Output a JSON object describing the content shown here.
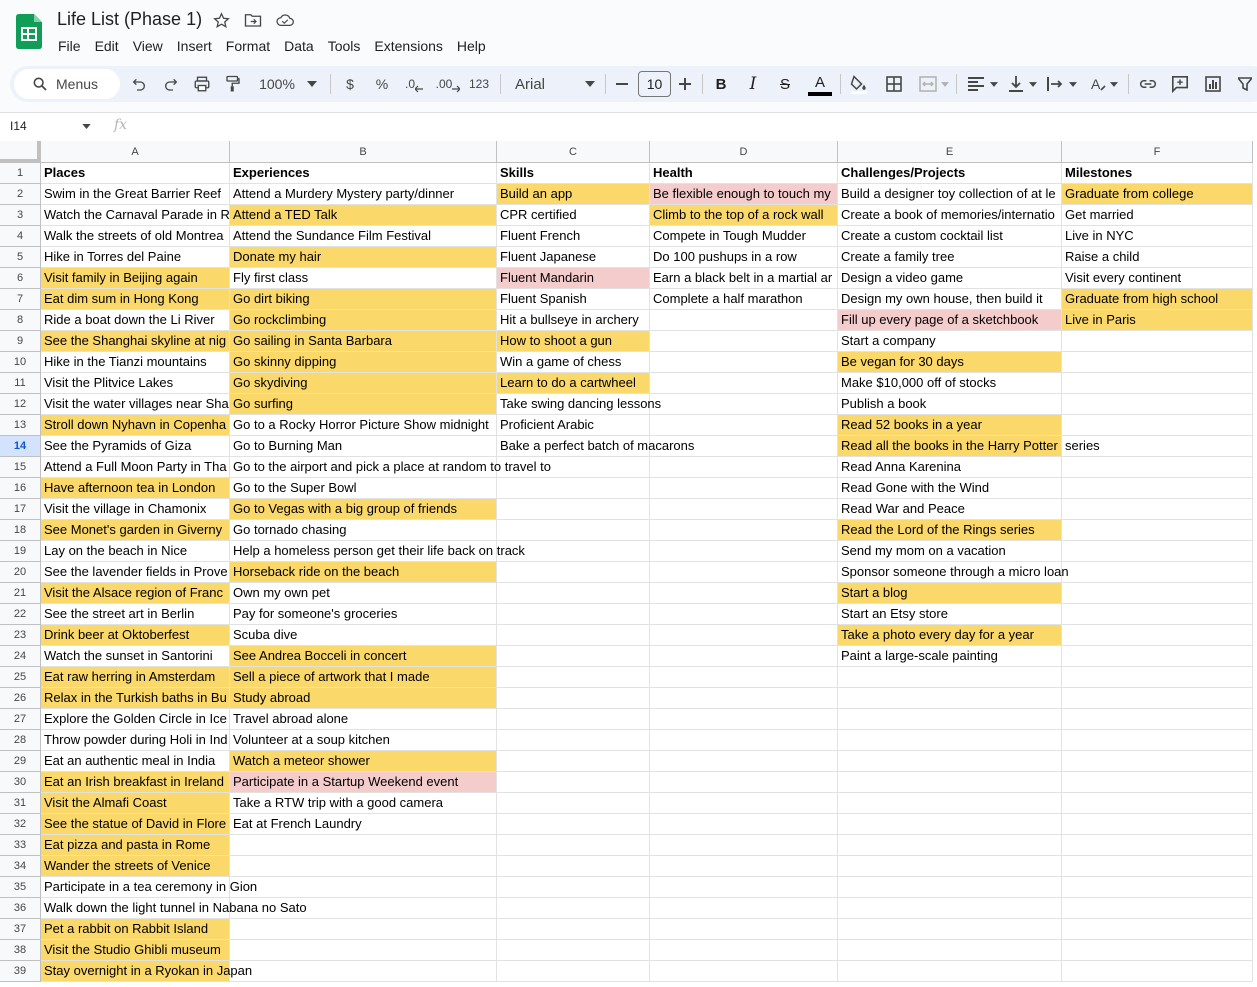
{
  "title": "Life List (Phase 1)",
  "menu": [
    "File",
    "Edit",
    "View",
    "Insert",
    "Format",
    "Data",
    "Tools",
    "Extensions",
    "Help"
  ],
  "toolbar": {
    "search_label": "Menus",
    "zoom": "100%",
    "currency": "$",
    "percent": "%",
    "decrease_decimal": ".0",
    "increase_decimal": ".00",
    "number_format": "123",
    "font": "Arial",
    "font_size": "10"
  },
  "formula": {
    "name_box": "I14",
    "fx": "fx",
    "value": ""
  },
  "columns": [
    "A",
    "B",
    "C",
    "D",
    "E",
    "F"
  ],
  "selected_row": 14,
  "rows": [
    [
      {
        "t": "Places",
        "h": 1
      },
      {
        "t": "Experiences",
        "h": 1
      },
      {
        "t": "Skills",
        "h": 1
      },
      {
        "t": "Health",
        "h": 1
      },
      {
        "t": "Challenges/Projects",
        "h": 1
      },
      {
        "t": "Milestones",
        "h": 1
      }
    ],
    [
      {
        "t": "Swim in the Great Barrier Reef"
      },
      {
        "t": "Attend a Murdery Mystery party/dinner"
      },
      {
        "t": "Build an app",
        "c": "y"
      },
      {
        "t": "Be flexible enough to touch my",
        "c": "p"
      },
      {
        "t": "Build a designer toy collection of at le"
      },
      {
        "t": "Graduate from college",
        "c": "y"
      }
    ],
    [
      {
        "t": "Watch the Carnaval Parade in R"
      },
      {
        "t": "Attend a TED Talk",
        "c": "y"
      },
      {
        "t": "CPR certified"
      },
      {
        "t": "Climb to the top of a rock wall",
        "c": "y"
      },
      {
        "t": "Create a book of memories/internatio"
      },
      {
        "t": "Get married"
      }
    ],
    [
      {
        "t": "Walk the streets of old Montrea"
      },
      {
        "t": "Attend the Sundance Film Festival"
      },
      {
        "t": "Fluent French"
      },
      {
        "t": "Compete in Tough Mudder"
      },
      {
        "t": "Create a custom cocktail list"
      },
      {
        "t": "Live in NYC"
      }
    ],
    [
      {
        "t": "Hike in Torres del Paine"
      },
      {
        "t": "Donate my hair",
        "c": "y"
      },
      {
        "t": "Fluent Japanese"
      },
      {
        "t": "Do 100 pushups in a row"
      },
      {
        "t": "Create a family tree"
      },
      {
        "t": "Raise a child"
      }
    ],
    [
      {
        "t": "Visit family in Beijing again",
        "c": "y"
      },
      {
        "t": "Fly first class"
      },
      {
        "t": "Fluent Mandarin",
        "c": "p"
      },
      {
        "t": "Earn a black belt in a martial ar"
      },
      {
        "t": "Design a video game"
      },
      {
        "t": "Visit every continent"
      }
    ],
    [
      {
        "t": "Eat dim sum in Hong Kong",
        "c": "y"
      },
      {
        "t": "Go dirt biking",
        "c": "y"
      },
      {
        "t": "Fluent Spanish"
      },
      {
        "t": "Complete a half marathon"
      },
      {
        "t": "Design my own house, then build it"
      },
      {
        "t": "Graduate from high school",
        "c": "y"
      }
    ],
    [
      {
        "t": "Ride a boat down the Li River"
      },
      {
        "t": "Go rockclimbing",
        "c": "y"
      },
      {
        "t": "Hit a bullseye in archery"
      },
      {
        "t": ""
      },
      {
        "t": "Fill up every page of a sketchbook",
        "c": "p"
      },
      {
        "t": "Live in Paris",
        "c": "y"
      }
    ],
    [
      {
        "t": "See the Shanghai skyline at nig",
        "c": "y"
      },
      {
        "t": "Go sailing in Santa Barbara",
        "c": "y"
      },
      {
        "t": "How to shoot a gun",
        "c": "y"
      },
      {
        "t": ""
      },
      {
        "t": "Start a company"
      },
      {
        "t": ""
      }
    ],
    [
      {
        "t": "Hike in the Tianzi mountains"
      },
      {
        "t": "Go skinny dipping",
        "c": "y"
      },
      {
        "t": "Win a game of chess"
      },
      {
        "t": ""
      },
      {
        "t": "Be vegan for 30 days",
        "c": "y"
      },
      {
        "t": ""
      }
    ],
    [
      {
        "t": "Visit the Plitvice Lakes"
      },
      {
        "t": "Go skydiving",
        "c": "y"
      },
      {
        "t": "Learn to do a cartwheel",
        "c": "y"
      },
      {
        "t": ""
      },
      {
        "t": "Make $10,000 off of stocks"
      },
      {
        "t": ""
      }
    ],
    [
      {
        "t": "Visit the water villages near Sha"
      },
      {
        "t": "Go surfing",
        "c": "y"
      },
      {
        "t": "Take swing dancing lessons",
        "o": 1
      },
      {
        "t": ""
      },
      {
        "t": "Publish a book"
      },
      {
        "t": ""
      }
    ],
    [
      {
        "t": "Stroll down Nyhavn in Copenha",
        "c": "y"
      },
      {
        "t": "Go to a Rocky Horror Picture Show midnight"
      },
      {
        "t": "Proficient Arabic"
      },
      {
        "t": ""
      },
      {
        "t": "Read 52 books in a year",
        "c": "y"
      },
      {
        "t": ""
      }
    ],
    [
      {
        "t": "See the Pyramids of Giza"
      },
      {
        "t": "Go to Burning Man"
      },
      {
        "t": "Bake a perfect batch of macarons",
        "o": 1
      },
      {
        "t": ""
      },
      {
        "t": "Read all the books in the Harry Potter",
        "c": "y"
      },
      {
        "t": "series"
      }
    ],
    [
      {
        "t": "Attend a Full Moon Party in Tha"
      },
      {
        "t": "Go to the airport and pick a place at random to travel to",
        "o": 1
      },
      {
        "t": ""
      },
      {
        "t": ""
      },
      {
        "t": "Read Anna Karenina"
      },
      {
        "t": ""
      }
    ],
    [
      {
        "t": "Have afternoon tea in London",
        "c": "y"
      },
      {
        "t": "Go to the Super Bowl"
      },
      {
        "t": ""
      },
      {
        "t": ""
      },
      {
        "t": "Read Gone with the Wind"
      },
      {
        "t": ""
      }
    ],
    [
      {
        "t": "Visit the village in Chamonix"
      },
      {
        "t": "Go to Vegas with a big group of friends",
        "c": "y"
      },
      {
        "t": ""
      },
      {
        "t": ""
      },
      {
        "t": "Read War and Peace"
      },
      {
        "t": ""
      }
    ],
    [
      {
        "t": "See Monet's garden in Giverny",
        "c": "y"
      },
      {
        "t": "Go tornado chasing"
      },
      {
        "t": ""
      },
      {
        "t": ""
      },
      {
        "t": "Read the Lord of the Rings series",
        "c": "y"
      },
      {
        "t": ""
      }
    ],
    [
      {
        "t": "Lay on the beach in Nice"
      },
      {
        "t": "Help a homeless person get their life back on track",
        "o": 1
      },
      {
        "t": ""
      },
      {
        "t": ""
      },
      {
        "t": "Send my mom on a vacation"
      },
      {
        "t": ""
      }
    ],
    [
      {
        "t": "See the lavender fields in Prove"
      },
      {
        "t": "Horseback ride on the beach",
        "c": "y"
      },
      {
        "t": ""
      },
      {
        "t": ""
      },
      {
        "t": "Sponsor someone through a micro loan",
        "o": 1
      },
      {
        "t": ""
      }
    ],
    [
      {
        "t": "Visit the Alsace region of Franc",
        "c": "y"
      },
      {
        "t": "Own my own pet"
      },
      {
        "t": ""
      },
      {
        "t": ""
      },
      {
        "t": "Start a blog",
        "c": "y"
      },
      {
        "t": ""
      }
    ],
    [
      {
        "t": "See the street art in Berlin"
      },
      {
        "t": "Pay for someone's groceries"
      },
      {
        "t": ""
      },
      {
        "t": ""
      },
      {
        "t": "Start an Etsy store"
      },
      {
        "t": ""
      }
    ],
    [
      {
        "t": "Drink beer at Oktoberfest",
        "c": "y"
      },
      {
        "t": "Scuba dive"
      },
      {
        "t": ""
      },
      {
        "t": ""
      },
      {
        "t": "Take a photo every day for a year",
        "c": "y"
      },
      {
        "t": ""
      }
    ],
    [
      {
        "t": "Watch the sunset in Santorini"
      },
      {
        "t": "See Andrea Bocceli in concert",
        "c": "y"
      },
      {
        "t": ""
      },
      {
        "t": ""
      },
      {
        "t": "Paint a large-scale painting"
      },
      {
        "t": ""
      }
    ],
    [
      {
        "t": "Eat raw herring in Amsterdam",
        "c": "y"
      },
      {
        "t": "Sell a piece of artwork that I made",
        "c": "y"
      },
      {
        "t": ""
      },
      {
        "t": ""
      },
      {
        "t": ""
      },
      {
        "t": ""
      }
    ],
    [
      {
        "t": "Relax in the Turkish baths in Bu",
        "c": "y"
      },
      {
        "t": "Study abroad",
        "c": "y"
      },
      {
        "t": ""
      },
      {
        "t": ""
      },
      {
        "t": ""
      },
      {
        "t": ""
      }
    ],
    [
      {
        "t": "Explore the Golden Circle in Ice"
      },
      {
        "t": "Travel abroad alone"
      },
      {
        "t": ""
      },
      {
        "t": ""
      },
      {
        "t": ""
      },
      {
        "t": ""
      }
    ],
    [
      {
        "t": "Throw powder during Holi in Ind"
      },
      {
        "t": "Volunteer at a soup kitchen"
      },
      {
        "t": ""
      },
      {
        "t": ""
      },
      {
        "t": ""
      },
      {
        "t": ""
      }
    ],
    [
      {
        "t": "Eat an authentic meal in India"
      },
      {
        "t": "Watch a meteor shower",
        "c": "y"
      },
      {
        "t": ""
      },
      {
        "t": ""
      },
      {
        "t": ""
      },
      {
        "t": ""
      }
    ],
    [
      {
        "t": "Eat an Irish breakfast in Ireland",
        "c": "y"
      },
      {
        "t": "Participate in a Startup Weekend event",
        "c": "p"
      },
      {
        "t": ""
      },
      {
        "t": ""
      },
      {
        "t": ""
      },
      {
        "t": ""
      }
    ],
    [
      {
        "t": "Visit the Almafi Coast",
        "c": "y"
      },
      {
        "t": "Take a RTW trip with a good camera"
      },
      {
        "t": ""
      },
      {
        "t": ""
      },
      {
        "t": ""
      },
      {
        "t": ""
      }
    ],
    [
      {
        "t": "See the statue of David in Flore",
        "c": "y"
      },
      {
        "t": "Eat at French Laundry"
      },
      {
        "t": ""
      },
      {
        "t": ""
      },
      {
        "t": ""
      },
      {
        "t": ""
      }
    ],
    [
      {
        "t": "Eat pizza and pasta in Rome",
        "c": "y"
      },
      {
        "t": ""
      },
      {
        "t": ""
      },
      {
        "t": ""
      },
      {
        "t": ""
      },
      {
        "t": ""
      }
    ],
    [
      {
        "t": "Wander the streets of Venice",
        "c": "y"
      },
      {
        "t": ""
      },
      {
        "t": ""
      },
      {
        "t": ""
      },
      {
        "t": ""
      },
      {
        "t": ""
      }
    ],
    [
      {
        "t": "Participate in a tea ceremony in Gion",
        "o": 1
      },
      {
        "t": ""
      },
      {
        "t": ""
      },
      {
        "t": ""
      },
      {
        "t": ""
      },
      {
        "t": ""
      }
    ],
    [
      {
        "t": "Walk down the light tunnel in Nabana no Sato",
        "o": 1
      },
      {
        "t": ""
      },
      {
        "t": ""
      },
      {
        "t": ""
      },
      {
        "t": ""
      },
      {
        "t": ""
      }
    ],
    [
      {
        "t": "Pet a rabbit on Rabbit Island",
        "c": "y"
      },
      {
        "t": ""
      },
      {
        "t": ""
      },
      {
        "t": ""
      },
      {
        "t": ""
      },
      {
        "t": ""
      }
    ],
    [
      {
        "t": "Visit the Studio Ghibli museum",
        "c": "y"
      },
      {
        "t": ""
      },
      {
        "t": ""
      },
      {
        "t": ""
      },
      {
        "t": ""
      },
      {
        "t": ""
      }
    ],
    [
      {
        "t": "Stay overnight in a Ryokan in Japan",
        "c": "y",
        "o": 1
      },
      {
        "t": ""
      },
      {
        "t": ""
      },
      {
        "t": ""
      },
      {
        "t": ""
      },
      {
        "t": ""
      }
    ]
  ]
}
